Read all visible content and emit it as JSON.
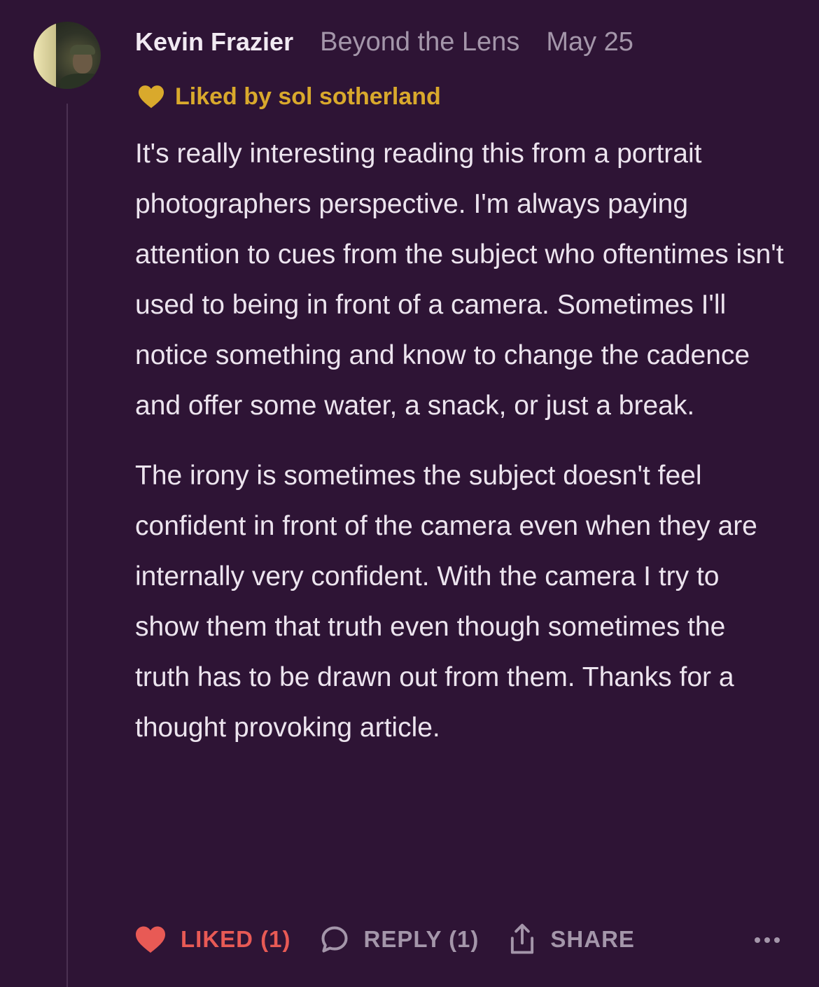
{
  "comment": {
    "author": "Kevin Frazier",
    "publication": "Beyond the Lens",
    "date": "May 25",
    "liked_by": "Liked by sol sotherland",
    "paragraphs": [
      "It's really interesting reading this from a portrait photographers perspective. I'm always paying attention to cues from the subject who oftentimes isn't used to being in front of a camera. Sometimes I'll notice something and know to change the cadence and offer some water, a snack, or just a break.",
      "The irony is sometimes the subject doesn't feel confident in front of the camera even when they are internally very confident. With the camera I try to show them that truth even though sometimes the truth has to be drawn out from them. Thanks for a thought provoking article."
    ]
  },
  "actions": {
    "like_label": "LIKED (1)",
    "reply_label": "REPLY (1)",
    "share_label": "SHARE"
  },
  "icons": {
    "liked_by": "heart-icon",
    "like": "heart-filled-icon",
    "reply": "speech-bubble-icon",
    "share": "share-arrow-icon",
    "more": "ellipsis-icon"
  },
  "colors": {
    "background": "#2e1435",
    "liked_by_gold": "#d9a92c",
    "liked_red": "#e85a55",
    "muted_text": "#a496aa"
  }
}
